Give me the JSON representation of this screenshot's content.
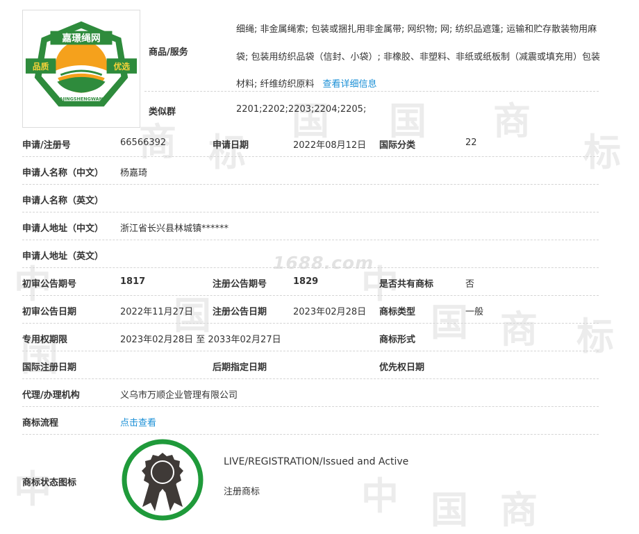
{
  "logo": {
    "top_text": "嘉璟绳网",
    "left_text": "品质",
    "right_text": "优选",
    "bottom_text": "JIAJINGSHENGWANG"
  },
  "watermark": {
    "site": "1688.com"
  },
  "goods": {
    "label": "商品/服务",
    "text": "细绳; 非金属绳索; 包装或捆扎用非金属带; 网织物; 网; 纺织品遮篷; 运输和贮存散装物用麻袋; 包装用纺织品袋（信封、小袋）; 非橡胶、非塑料、非纸或纸板制（减震或填充用）包装材料; 纤维纺织原料",
    "link": "查看详细信息"
  },
  "similar": {
    "label": "类似群",
    "value": "2201;2202;2203;2204;2205;"
  },
  "rows": {
    "r1": {
      "l1": "申请/注册号",
      "v1": "66566392",
      "l2": "申请日期",
      "v2": "2022年08月12日",
      "l3": "国际分类",
      "v3": "22"
    },
    "r2": {
      "l1": "申请人名称（中文）",
      "v1": "杨嘉琦"
    },
    "r3": {
      "l1": "申请人名称（英文）"
    },
    "r4": {
      "l1": "申请人地址（中文）",
      "v1": "浙江省长兴县林城镇******"
    },
    "r5": {
      "l1": "申请人地址（英文）"
    },
    "r6": {
      "l1": "初审公告期号",
      "v1": "1817",
      "l2": "注册公告期号",
      "v2": "1829",
      "l3": "是否共有商标",
      "v3": "否"
    },
    "r7": {
      "l1": "初审公告日期",
      "v1": "2022年11月27日",
      "l2": "注册公告日期",
      "v2": "2023年02月28日",
      "l3": "商标类型",
      "v3": "一般"
    },
    "r8": {
      "l1": "专用权期限",
      "v1": "2023年02月28日 至 2033年02月27日",
      "l3": "商标形式"
    },
    "r9": {
      "l1": "国际注册日期",
      "l2": "后期指定日期",
      "l3": "优先权日期"
    },
    "r10": {
      "l1": "代理/办理机构",
      "v1": "义乌市万顺企业管理有限公司"
    },
    "r11": {
      "l1": "商标流程",
      "link": "点击查看"
    }
  },
  "status": {
    "label": "商标状态图标",
    "english": "LIVE/REGISTRATION/Issued and Active",
    "chinese": "注册商标",
    "ring_color": "#1f9a3a",
    "badge_color": "#3f3a37"
  },
  "colors": {
    "link": "#1a8fd6",
    "logo_green": "#2e8b3c",
    "logo_orange": "#f5a11c"
  }
}
